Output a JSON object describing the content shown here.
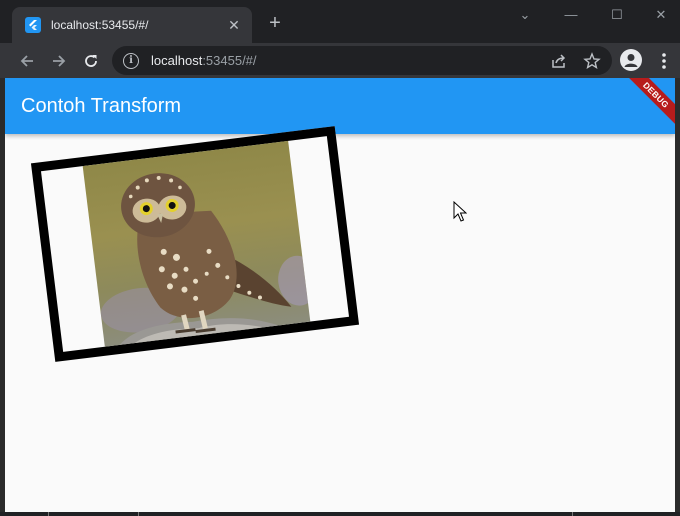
{
  "browser": {
    "tab": {
      "title": "localhost:53455/#/",
      "close_glyph": "✕"
    },
    "new_tab_glyph": "+",
    "window_controls": {
      "collapse": "⌄",
      "minimize": "—",
      "maximize": "☐",
      "close": "✕"
    },
    "address": {
      "host": "localhost",
      "rest": ":53455/#/"
    }
  },
  "app": {
    "title": "Contoh Transform",
    "debug_banner": "DEBUG",
    "theme_color": "#2196f3",
    "image": {
      "subject": "owl-photo",
      "rotation_deg": -7
    }
  },
  "icons": [
    "flutter-icon",
    "back-icon",
    "forward-icon",
    "reload-icon",
    "info-icon",
    "share-icon",
    "star-icon",
    "profile-icon",
    "menu-icon",
    "mouse-cursor-icon"
  ]
}
